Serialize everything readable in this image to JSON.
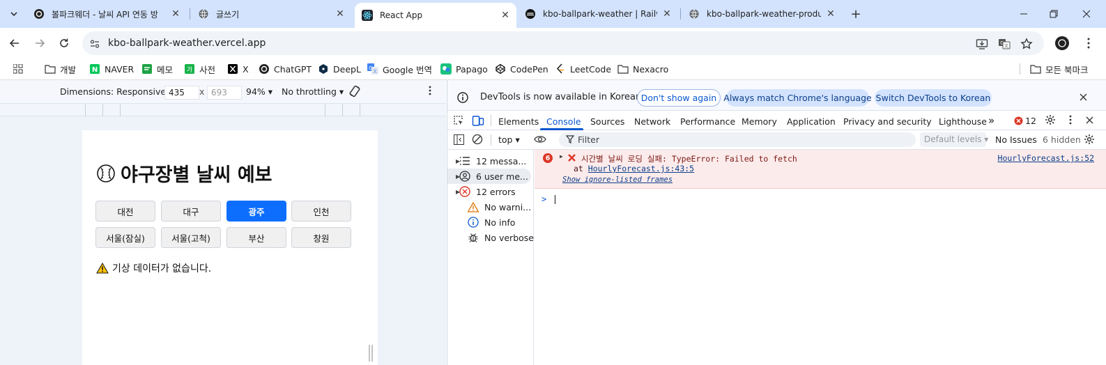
{
  "tabs": [
    {
      "title": "볼파크웨더 - 날씨 API 연동 방",
      "favicon": "openai-icon",
      "active": false
    },
    {
      "title": "글쓰기",
      "favicon": "globe-icon",
      "active": false
    },
    {
      "title": "React App",
      "favicon": "react-icon",
      "active": true
    },
    {
      "title": "kbo-ballpark-weather | Railway",
      "favicon": "railway-icon",
      "active": false
    },
    {
      "title": "kbo-ballpark-weather-producti",
      "favicon": "globe-icon",
      "active": false
    }
  ],
  "address": {
    "url": "kbo-ballpark-weather.vercel.app"
  },
  "bookmarks": [
    {
      "label": "개발",
      "icon": "folder-icon"
    },
    {
      "label": "NAVER",
      "icon": "naver-icon"
    },
    {
      "label": "메모",
      "icon": "memo-icon"
    },
    {
      "label": "사전",
      "icon": "dictionary-icon"
    },
    {
      "label": "X",
      "icon": "x-icon"
    },
    {
      "label": "ChatGPT",
      "icon": "openai-icon"
    },
    {
      "label": "DeepL",
      "icon": "deepl-icon"
    },
    {
      "label": "Google 번역",
      "icon": "google-translate-icon"
    },
    {
      "label": "Papago",
      "icon": "papago-icon"
    },
    {
      "label": "CodePen",
      "icon": "codepen-icon"
    },
    {
      "label": "LeetCode",
      "icon": "leetcode-icon"
    },
    {
      "label": "Nexacro",
      "icon": "folder-icon"
    },
    {
      "label": "모든 북마크",
      "icon": "folder-icon"
    }
  ],
  "device_toolbar": {
    "dimensions_label": "Dimensions: Responsive",
    "width": "435",
    "times": "x",
    "height_placeholder": "693",
    "zoom": "94%",
    "throttling": "No throttling"
  },
  "app": {
    "title": "야구장별 날씨 예보",
    "stadiums": [
      "대전",
      "대구",
      "광주",
      "인천",
      "서울(잠실)",
      "서울(고척)",
      "부산",
      "창원"
    ],
    "selected": "광주",
    "warning": "기상 데이터가 없습니다."
  },
  "devtools": {
    "info_message": "DevTools is now available in Korean",
    "dont_show": "Don't show again",
    "match_language": "Always match Chrome's language",
    "switch_korean": "Switch DevTools to Korean",
    "tabs": [
      "Elements",
      "Console",
      "Sources",
      "Network",
      "Performance",
      "Memory",
      "Application",
      "Privacy and security",
      "Lighthouse"
    ],
    "active_tab": "Console",
    "error_count": "12",
    "context": "top",
    "filter_placeholder": "Filter",
    "levels": "Default levels",
    "issues": "No Issues",
    "hidden": "6 hidden",
    "sidebar": [
      {
        "label": "12 messa...",
        "icon": "list-icon",
        "expandable": true
      },
      {
        "label": "6 user me...",
        "icon": "user-icon",
        "expandable": true
      },
      {
        "label": "12 errors",
        "icon": "error-icon",
        "expandable": true
      },
      {
        "label": "No warni...",
        "icon": "warning-icon",
        "expandable": false
      },
      {
        "label": "No info",
        "icon": "info-icon",
        "expandable": false
      },
      {
        "label": "No verbose",
        "icon": "bug-icon",
        "expandable": false
      }
    ],
    "error": {
      "count": "6",
      "message": "시간별 날씨 로딩 실패: TypeError: Failed to fetch",
      "at_prefix": "at ",
      "at_link": "HourlyForecast.js:43:5",
      "ignore_frames": "Show ignore-listed frames",
      "source": "HourlyForecast.js:52"
    },
    "prompt": ">"
  }
}
